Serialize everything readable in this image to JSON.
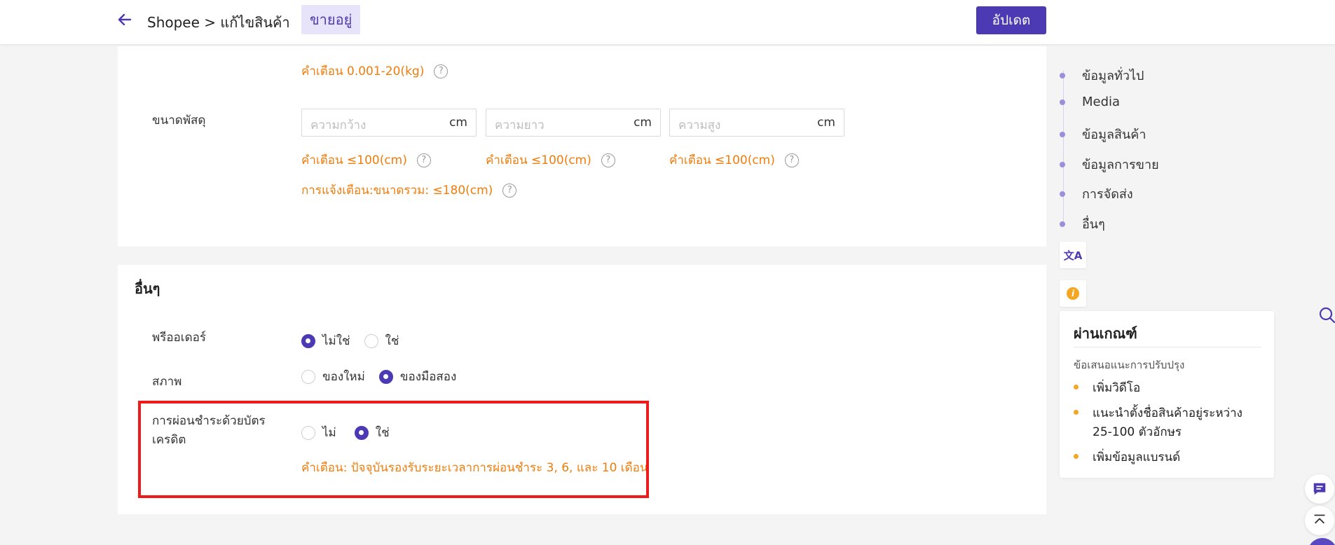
{
  "header": {
    "breadcrumb": "Shopee > แก้ไขสินค้า",
    "status_tag": "ขายอยู่",
    "update_button": "อัปเดต"
  },
  "shipping": {
    "weight_hint": "คำเตือน 0.001-20(kg)",
    "dimension_label": "ขนาดพัสดุ",
    "width": {
      "placeholder": "ความกว้าง",
      "unit": "cm",
      "hint": "คำเตือน ≤100(cm)"
    },
    "length": {
      "placeholder": "ความยาว",
      "unit": "cm",
      "hint": "คำเตือน ≤100(cm)"
    },
    "height": {
      "placeholder": "ความสูง",
      "unit": "cm",
      "hint": "คำเตือน ≤100(cm)"
    },
    "total_hint": "การแจ้งเตือน:ขนาดรวม: ≤180(cm)"
  },
  "others": {
    "title": "อื่นๆ",
    "preorder": {
      "label": "พรีออเดอร์",
      "options": [
        "ไม่ใช่",
        "ใช่"
      ],
      "selected": "ไม่ใช่"
    },
    "condition": {
      "label": "สภาพ",
      "options": [
        "ของใหม่",
        "ของมือสอง"
      ],
      "selected": "ของมือสอง"
    },
    "installment": {
      "label_line1": "การผ่อนชำระด้วยบัตร",
      "label_line2": "เครดิต",
      "options": [
        "ไม่",
        "ใช่"
      ],
      "selected": "ใช่",
      "hint": "คำเตือน: ปัจจุบันรองรับระยะเวลาการผ่อนชำระ 3, 6, และ 10 เดือน"
    }
  },
  "anchor_nav": {
    "items": [
      "ข้อมูลทั่วไป",
      "Media",
      "ข้อมูลสินค้า",
      "ข้อมูลการขาย",
      "การจัดส่ง",
      "อื่นๆ"
    ]
  },
  "side_tools": {
    "translate_icon": "translate-icon",
    "info_icon": "info-icon"
  },
  "quality": {
    "title": "ผ่านเกณฑ์",
    "subtitle": "ข้อเสนอแนะการปรับปรุง",
    "items": [
      "เพิ่มวิดีโอ",
      "แนะนำตั้งชื่อสินค้าอยู่ระหว่าง 25-100 ตัวอักษร",
      "เพิ่มข้อมูลแบรนด์"
    ]
  },
  "colors": {
    "brand": "#4b3ab3",
    "warning": "#f27c0b",
    "highlight": "#ee1b1b",
    "bullet": "#f5a623"
  }
}
